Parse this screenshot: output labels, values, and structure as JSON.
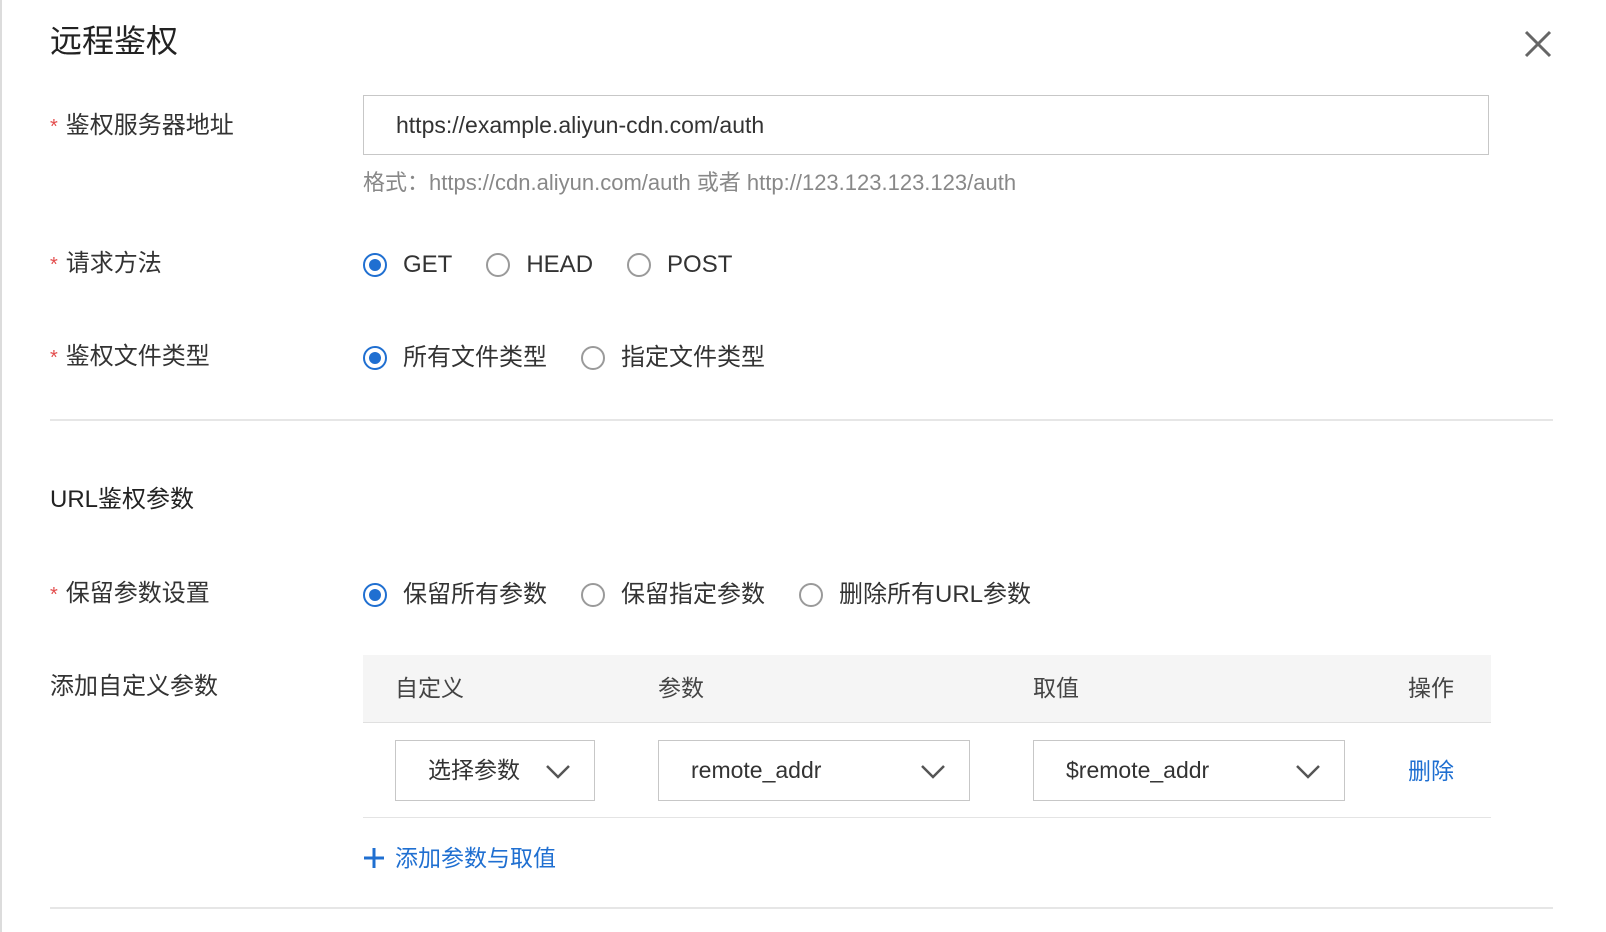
{
  "dialog": {
    "title": "远程鉴权"
  },
  "form": {
    "auth_server": {
      "label": "鉴权服务器地址",
      "value": "https://example.aliyun-cdn.com/auth",
      "hint": "格式：https://cdn.aliyun.com/auth 或者 http://123.123.123.123/auth"
    },
    "method": {
      "label": "请求方法",
      "options": [
        "GET",
        "HEAD",
        "POST"
      ],
      "selected": "GET"
    },
    "file_type": {
      "label": "鉴权文件类型",
      "options": [
        "所有文件类型",
        "指定文件类型"
      ],
      "selected": "所有文件类型"
    }
  },
  "url_params": {
    "section_title": "URL鉴权参数",
    "keep": {
      "label": "保留参数设置",
      "options": [
        "保留所有参数",
        "保留指定参数",
        "删除所有URL参数"
      ],
      "selected": "保留所有参数"
    },
    "custom": {
      "label": "添加自定义参数",
      "columns": [
        "自定义",
        "参数",
        "取值",
        "操作"
      ],
      "rows": [
        {
          "custom": "选择参数",
          "param": "remote_addr",
          "value": "$remote_addr",
          "action": "删除"
        }
      ],
      "add_label": "添加参数与取值"
    }
  },
  "required_mark": "*",
  "colors": {
    "accent": "#1f6fd1",
    "required": "#e34d4d"
  }
}
